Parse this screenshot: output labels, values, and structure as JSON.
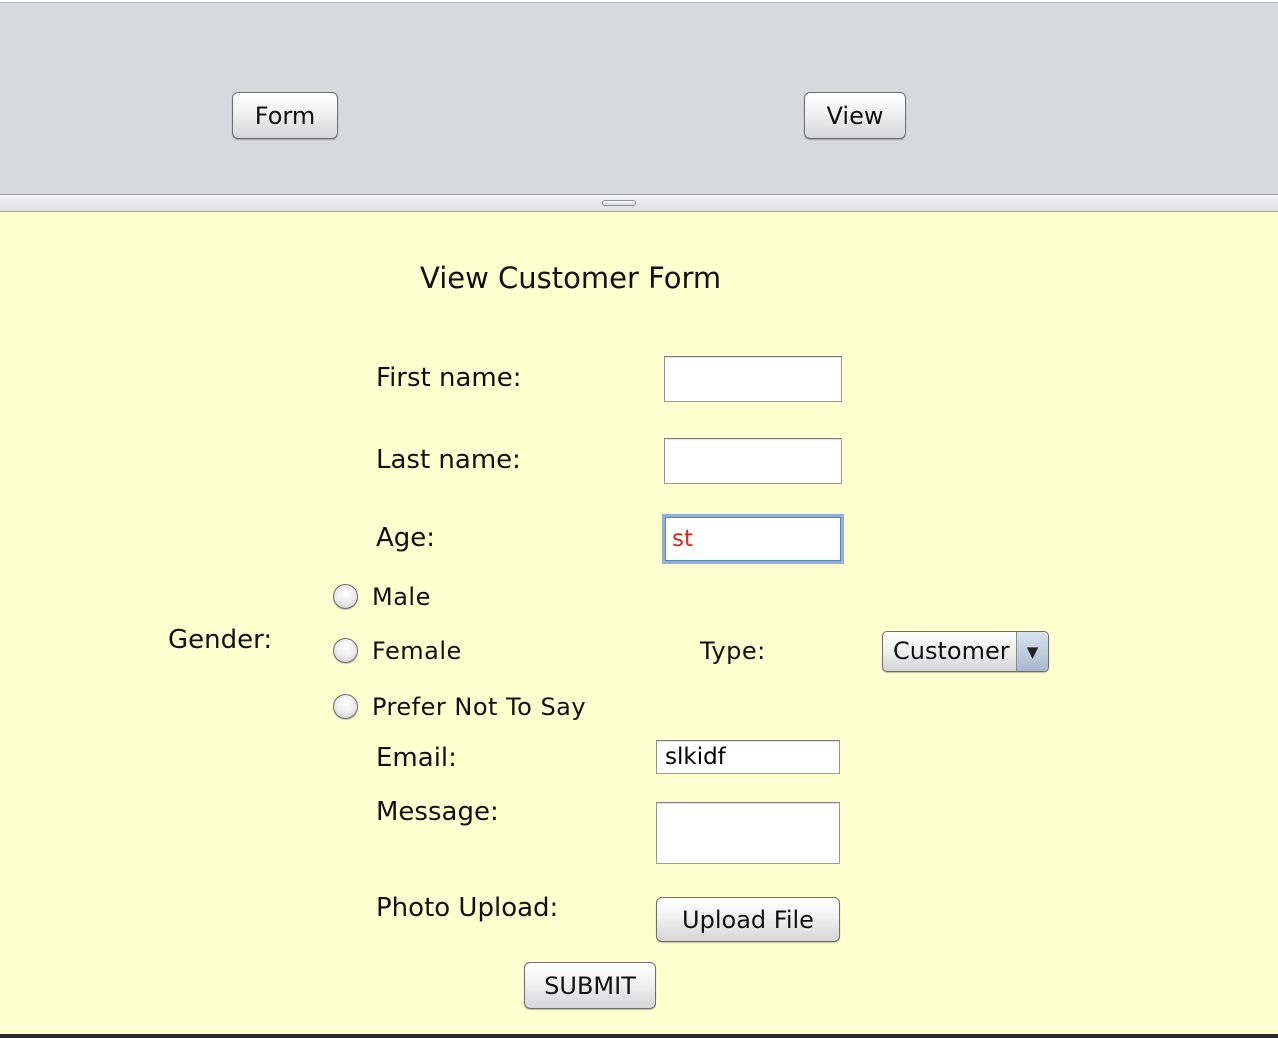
{
  "toolbar": {
    "form_label": "Form",
    "view_label": "View"
  },
  "form": {
    "title": "View Customer Form",
    "first_name": {
      "label": "First name:",
      "value": ""
    },
    "last_name": {
      "label": "Last name:",
      "value": ""
    },
    "age": {
      "label": "Age:",
      "value": "st"
    },
    "gender": {
      "label": "Gender:",
      "options": [
        "Male",
        "Female",
        "Prefer Not To Say"
      ]
    },
    "type": {
      "label": "Type:",
      "selected": "Customer"
    },
    "email": {
      "label": "Email:",
      "value": "slkidf"
    },
    "message": {
      "label": "Message:",
      "value": ""
    },
    "photo": {
      "label": "Photo Upload:",
      "button_label": "Upload File"
    },
    "submit_label": "SUBMIT"
  },
  "colors": {
    "top_panel": "#d8d9dc",
    "form_background": "#ffffcf",
    "invalid_text": "#e0261b",
    "focus_ring": "#8fb1d6"
  }
}
